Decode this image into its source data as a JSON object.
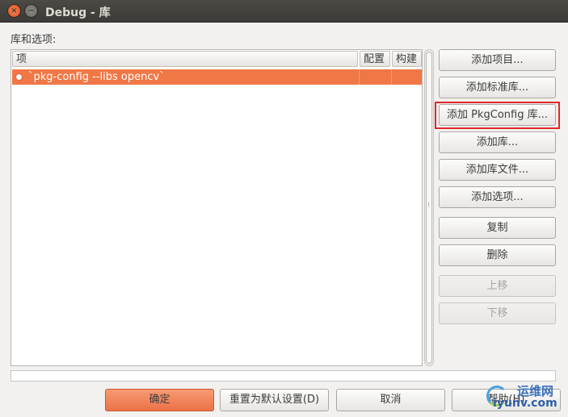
{
  "window": {
    "title": "Debug - 库",
    "close_glyph": "×",
    "minimize_glyph": "−"
  },
  "library_panel": {
    "label": "库和选项:",
    "columns": [
      "项",
      "配置",
      "构建"
    ],
    "rows": [
      {
        "item": "`pkg-config --libs opencv`",
        "config": "",
        "build": ""
      }
    ]
  },
  "side_buttons": {
    "add_item": "添加项目...",
    "add_standard_library": "添加标准库...",
    "add_pkgconfig_library": "添加 PkgConfig 库...",
    "add_library": "添加库...",
    "add_library_file": "添加库文件...",
    "add_option": "添加选项...",
    "copy": "复制",
    "delete": "删除",
    "move_up": "上移",
    "move_down": "下移"
  },
  "bottom_buttons": {
    "ok": "确定",
    "reset_defaults": "重置为默认设置(D)",
    "cancel": "取消",
    "help": "帮助(H)"
  },
  "watermark": {
    "text": "运维网",
    "sub": "iyunv.com"
  },
  "colors": {
    "accent": "#f07746",
    "highlight_box": "#e0262a",
    "titlebar": "#3c3b37"
  }
}
